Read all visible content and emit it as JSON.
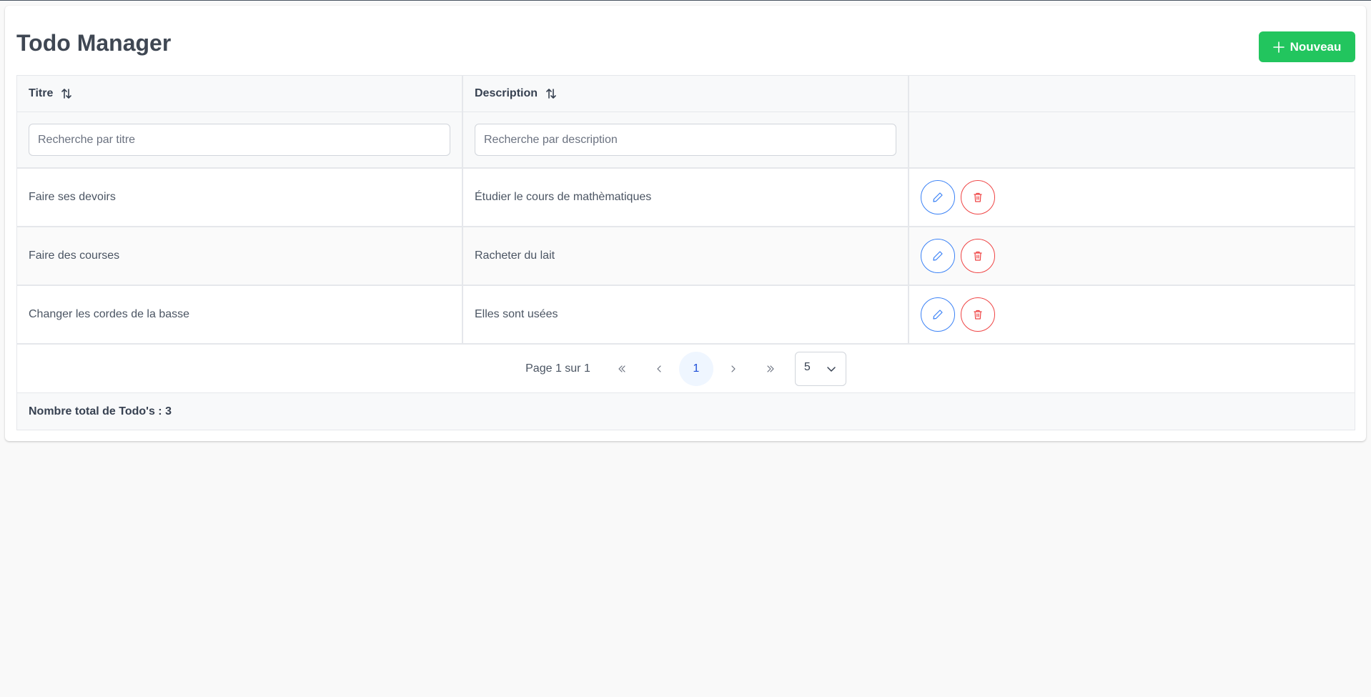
{
  "header": {
    "title": "Todo Manager",
    "new_button_label": "Nouveau"
  },
  "table": {
    "columns": [
      {
        "label": "Titre",
        "sortable": true
      },
      {
        "label": "Description",
        "sortable": true
      },
      {
        "label": ""
      }
    ],
    "filters": {
      "title_placeholder": "Recherche par titre",
      "description_placeholder": "Recherche par description"
    },
    "rows": [
      {
        "title": "Faire ses devoirs",
        "description": "Étudier le cours de mathèmatiques"
      },
      {
        "title": "Faire des courses",
        "description": "Racheter du lait"
      },
      {
        "title": "Changer les cordes de la basse",
        "description": "Elles sont usées"
      }
    ]
  },
  "paginator": {
    "report": "Page 1 sur 1",
    "current_page": "1",
    "rows_per_page": "5"
  },
  "footer": {
    "total_text": "Nombre total de Todo's : 3"
  },
  "colors": {
    "primary_green": "#22c55e",
    "edit_blue": "#3b82f6",
    "delete_red": "#ef4444"
  }
}
